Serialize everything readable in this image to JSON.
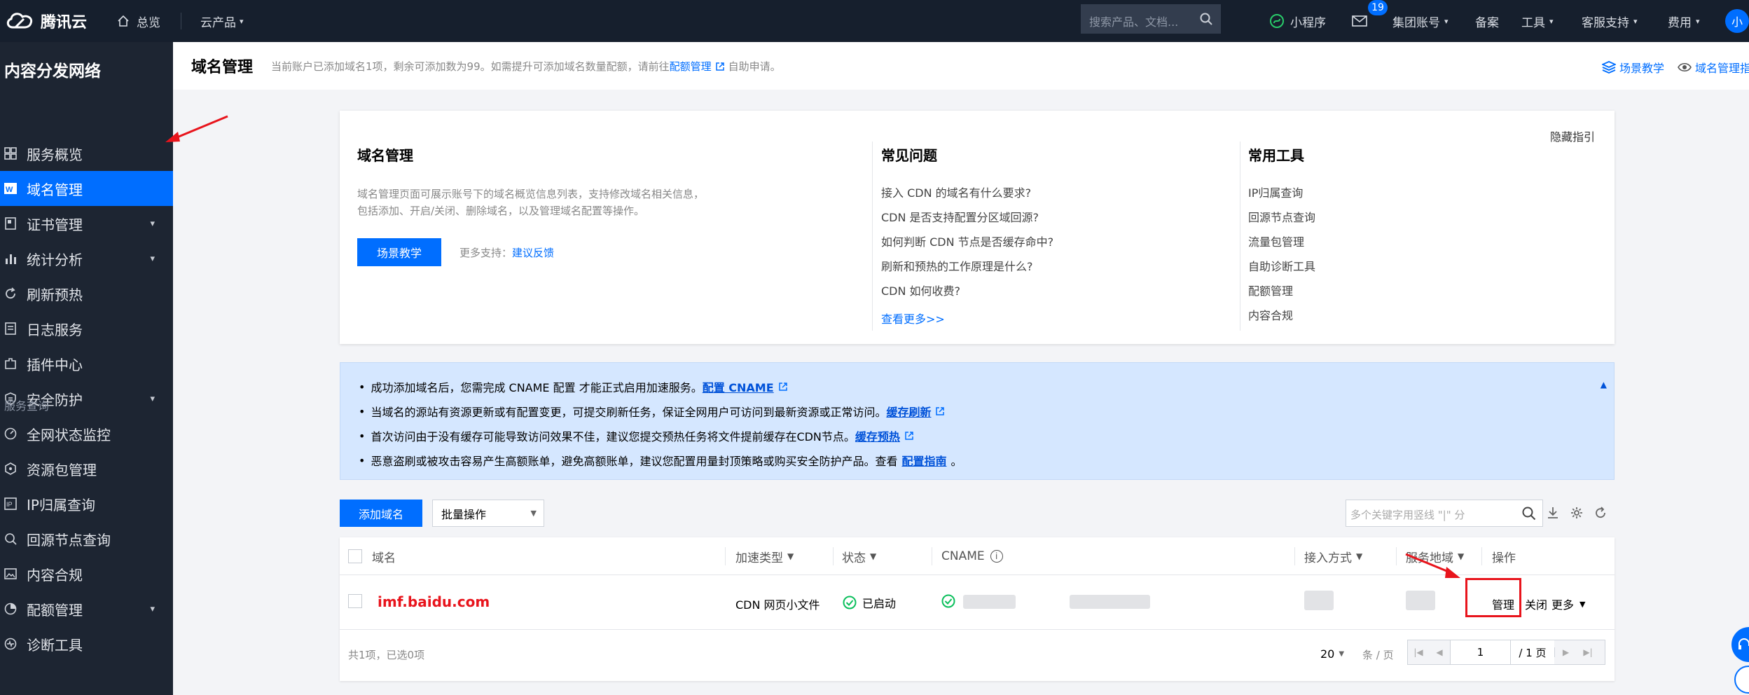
{
  "topbar": {
    "brand": "腾讯云",
    "nav_home": "总览",
    "nav_products": "云产品",
    "search_placeholder": "搜索产品、文档...",
    "mini_program": "小程序",
    "mail_badge": "19",
    "group_account": "集团账号",
    "filing": "备案",
    "tools": "工具",
    "support": "客服支持",
    "billing": "费用",
    "avatar": "小"
  },
  "sidebar": {
    "title": "内容分发网络",
    "items": [
      {
        "label": "服务概览",
        "icon": "dashboard-icon"
      },
      {
        "label": "域名管理",
        "icon": "domain-icon",
        "active": true
      },
      {
        "label": "证书管理",
        "icon": "certificate-icon",
        "expandable": true
      },
      {
        "label": "统计分析",
        "icon": "bar-chart-icon",
        "expandable": true
      },
      {
        "label": "刷新预热",
        "icon": "refresh-icon"
      },
      {
        "label": "日志服务",
        "icon": "log-icon"
      },
      {
        "label": "插件中心",
        "icon": "plugin-icon"
      },
      {
        "label": "安全防护",
        "icon": "shield-icon",
        "expandable": true
      }
    ],
    "group_label": "服务查询",
    "group_items": [
      {
        "label": "全网状态监控",
        "icon": "monitor-icon"
      },
      {
        "label": "资源包管理",
        "icon": "package-icon"
      },
      {
        "label": "IP归属查询",
        "icon": "ip-icon"
      },
      {
        "label": "回源节点查询",
        "icon": "search-node-icon"
      },
      {
        "label": "内容合规",
        "icon": "image-icon"
      },
      {
        "label": "配额管理",
        "icon": "pie-icon",
        "expandable": true
      },
      {
        "label": "诊断工具",
        "icon": "diagnose-icon"
      }
    ]
  },
  "header": {
    "title": "域名管理",
    "desc_prefix": "当前账户已添加域名1项，剩余可添加数为99。如需提升可添加域名数量配额，请前往",
    "desc_link": "配额管理",
    "desc_suffix": "自助申请。",
    "scene_tutorial": "场景教学",
    "domain_guide": "域名管理指引"
  },
  "guide": {
    "title": "域名管理",
    "desc_line1": "域名管理页面可展示账号下的域名概览信息列表，支持修改域名相关信息，",
    "desc_line2": "包括添加、开启/关闭、删除域名，以及管理域名配置等操作。",
    "button": "场景教学",
    "more_support": "更多支持：",
    "feedback": "建议反馈",
    "hide": "隐藏指引",
    "faq_title": "常见问题",
    "faq": [
      "接入 CDN 的域名有什么要求?",
      "CDN 是否支持配置分区域回源?",
      "如何判断 CDN 节点是否缓存命中?",
      "刷新和预热的工作原理是什么?",
      "CDN 如何收费?"
    ],
    "faq_more": "查看更多>>",
    "tools_title": "常用工具",
    "tools": [
      "IP归属查询",
      "回源节点查询",
      "流量包管理",
      "自助诊断工具",
      "配额管理",
      "内容合规"
    ]
  },
  "notice": {
    "rows": [
      {
        "text": "成功添加域名后，您需完成 CNAME 配置 才能正式启用加速服务。",
        "link": "配置 CNAME"
      },
      {
        "text": "当域名的源站有资源更新或有配置变更，可提交刷新任务，保证全网用户可访问到最新资源或正常访问。",
        "link": "缓存刷新"
      },
      {
        "text": "首次访问由于没有缓存可能导致访问效果不佳，建议您提交预热任务将文件提前缓存在CDN节点。",
        "link": "缓存预热"
      },
      {
        "text": "恶意盗刷或被攻击容易产生高额账单，避免高额账单，建议您配置用量封顶策略或购买安全防护产品。查看",
        "link": "配置指南",
        "suffix": "。"
      }
    ]
  },
  "toolbar": {
    "add_domain": "添加域名",
    "batch": "批量操作",
    "search_placeholder": "多个关键字用竖线 \"|\" 分"
  },
  "table": {
    "headers": {
      "domain": "域名",
      "type": "加速类型",
      "status": "状态",
      "cname": "CNAME",
      "access": "接入方式",
      "region": "服务地域",
      "ops": "操作"
    },
    "rows": [
      {
        "domain": "imf.baidu.com",
        "type": "CDN 网页小文件",
        "status": "已启动",
        "cname": "",
        "access": "",
        "region": "",
        "op_manage": "管理",
        "op_close": "关闭",
        "op_more": "更多"
      }
    ],
    "footer_count": "共1项，已选0项",
    "page_size": "20",
    "per_page": "条 / 页",
    "page_current": "1",
    "page_total": "/ 1 页"
  },
  "colors": {
    "accent": "#006eff",
    "topbar": "#161f2d",
    "sidebar": "#1d2532",
    "status_ok": "#0abf5b",
    "annotation": "#e8141c"
  }
}
